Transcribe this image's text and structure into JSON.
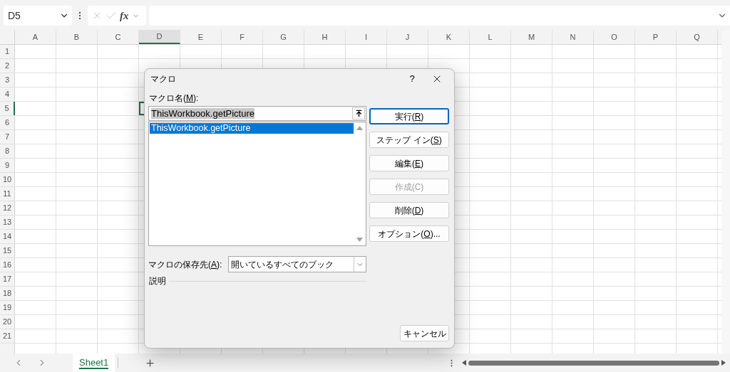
{
  "name_box": {
    "value": "D5"
  },
  "formula_bar": {
    "function_label": "fx"
  },
  "columns": [
    {
      "label": "A",
      "selected": false
    },
    {
      "label": "B",
      "selected": false
    },
    {
      "label": "C",
      "selected": false
    },
    {
      "label": "D",
      "selected": true
    },
    {
      "label": "E",
      "selected": false
    },
    {
      "label": "F",
      "selected": false
    },
    {
      "label": "G",
      "selected": false
    },
    {
      "label": "H",
      "selected": false
    },
    {
      "label": "I",
      "selected": false
    },
    {
      "label": "J",
      "selected": false
    },
    {
      "label": "K",
      "selected": false
    },
    {
      "label": "L",
      "selected": false
    },
    {
      "label": "M",
      "selected": false
    },
    {
      "label": "N",
      "selected": false
    },
    {
      "label": "O",
      "selected": false
    },
    {
      "label": "P",
      "selected": false
    },
    {
      "label": "Q",
      "selected": false
    }
  ],
  "rows": [
    {
      "label": "1",
      "selected": false
    },
    {
      "label": "2",
      "selected": false
    },
    {
      "label": "3",
      "selected": false
    },
    {
      "label": "4",
      "selected": false
    },
    {
      "label": "5",
      "selected": true
    },
    {
      "label": "6",
      "selected": false
    },
    {
      "label": "7",
      "selected": false
    },
    {
      "label": "8",
      "selected": false
    },
    {
      "label": "9",
      "selected": false
    },
    {
      "label": "10",
      "selected": false
    },
    {
      "label": "11",
      "selected": false
    },
    {
      "label": "12",
      "selected": false
    },
    {
      "label": "13",
      "selected": false
    },
    {
      "label": "14",
      "selected": false
    },
    {
      "label": "15",
      "selected": false
    },
    {
      "label": "16",
      "selected": false
    },
    {
      "label": "17",
      "selected": false
    },
    {
      "label": "18",
      "selected": false
    },
    {
      "label": "19",
      "selected": false
    },
    {
      "label": "20",
      "selected": false
    },
    {
      "label": "21",
      "selected": false
    }
  ],
  "sheet_tabs": [
    {
      "label": "Sheet1",
      "selected": true
    }
  ],
  "dialog": {
    "title": "マクロ",
    "help": "?",
    "macro_name": {
      "label": [
        "マクロ名(",
        "M",
        "):"
      ],
      "value": "ThisWorkbook.getPicture"
    },
    "macros": [
      {
        "label": "ThisWorkbook.getPicture",
        "selected": true
      }
    ],
    "buttons": [
      {
        "label": [
          "実行(",
          "R",
          ")"
        ],
        "default": true,
        "disabled": false
      },
      {
        "label": [
          "ステップ イン(",
          "S",
          ")"
        ],
        "default": false,
        "disabled": false
      },
      {
        "label": [
          "編集(",
          "E",
          ")"
        ],
        "default": false,
        "disabled": false
      },
      {
        "label": [
          "作成(C)"
        ],
        "default": false,
        "disabled": true
      },
      {
        "label": [
          "削除(",
          "D",
          ")"
        ],
        "default": false,
        "disabled": false
      },
      {
        "label": [
          "オプション(",
          "O",
          ")..."
        ],
        "default": false,
        "disabled": false
      }
    ],
    "store": {
      "label": [
        "マクロの保存先(",
        "A",
        "):"
      ],
      "value": "開いているすべてのブック"
    },
    "description": {
      "label": "説明"
    },
    "cancel": {
      "label": [
        "キャンセル"
      ]
    }
  }
}
